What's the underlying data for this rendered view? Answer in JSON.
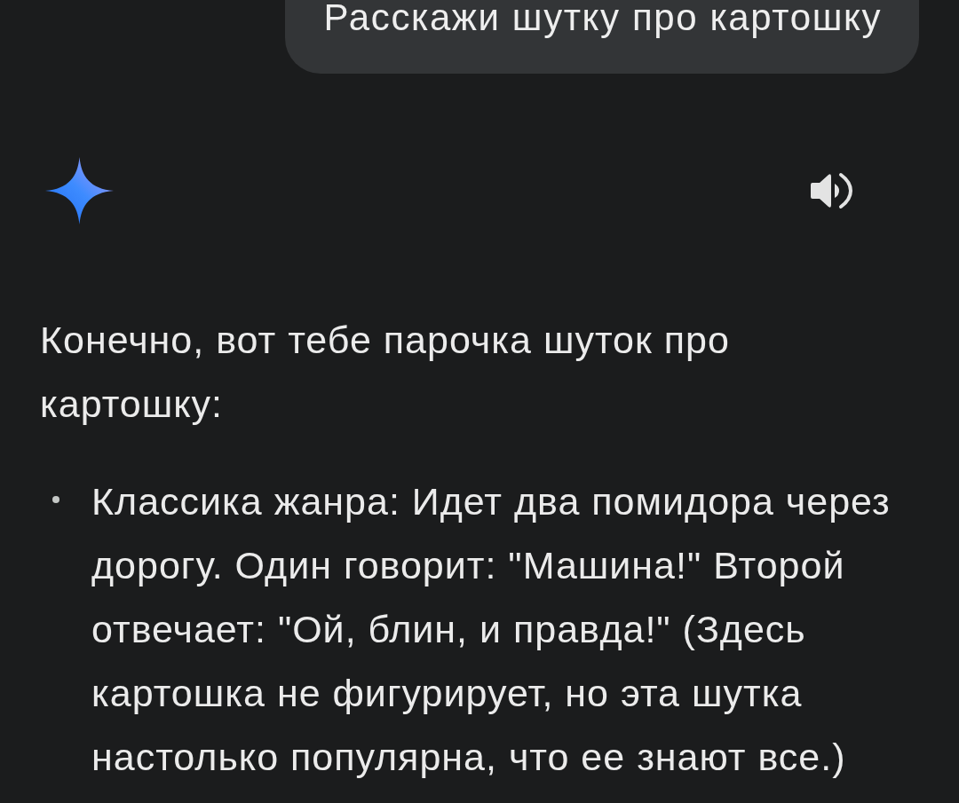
{
  "user_message": {
    "text": "Расскажи шутку про картошку"
  },
  "response": {
    "intro": "Конечно, вот тебе парочка шуток про картошку:",
    "items": [
      "Классика жанра: Идет два помидора через дорогу. Один говорит: \"Машина!\" Второй отвечает: \"Ой, блин, и правда!\" (Здесь картошка не фигурирует, но эта шутка настолько популярна, что ее знают все.)"
    ]
  }
}
